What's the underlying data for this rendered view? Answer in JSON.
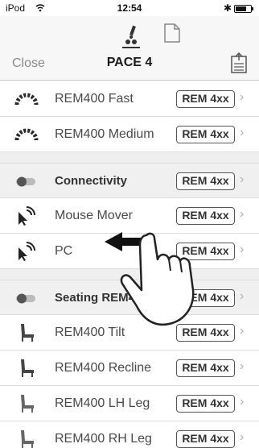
{
  "status_bar": {
    "carrier": "iPod",
    "time": "12:54"
  },
  "nav": {
    "close_label": "Close",
    "title": "PACE 4"
  },
  "sections": [
    {
      "type": "row",
      "icon": "speed-gauge-icon",
      "label": "REM400 Fast",
      "badge": "REM 4xx"
    },
    {
      "type": "row",
      "icon": "speed-gauge-icon",
      "label": "REM400 Medium",
      "badge": "REM 4xx"
    },
    {
      "type": "header",
      "icon": "toggle-icon",
      "label": "Connectivity",
      "badge": "REM 4xx"
    },
    {
      "type": "row",
      "icon": "mouse-wireless-icon",
      "label": "Mouse Mover",
      "badge": "REM 4xx"
    },
    {
      "type": "row",
      "icon": "mouse-wireless-icon",
      "label": "PC",
      "badge": "REM 4xx"
    },
    {
      "type": "header",
      "icon": "toggle-icon",
      "label": "Seating REM400",
      "badge": "REM 4xx"
    },
    {
      "type": "row",
      "icon": "seat-icon",
      "label": "REM400 Tilt",
      "badge": "REM 4xx"
    },
    {
      "type": "row",
      "icon": "seat-icon",
      "label": "REM400 Recline",
      "badge": "REM 4xx"
    },
    {
      "type": "row",
      "icon": "seat-icon",
      "label": "REM400 LH Leg",
      "badge": "REM 4xx"
    },
    {
      "type": "row",
      "icon": "seat-icon",
      "label": "REM400 RH Leg",
      "badge": "REM 4xx"
    }
  ],
  "colors": {
    "nav_bg": "#f7f7f7",
    "header_bg": "#f0f0f0",
    "text": "#4a4a4a"
  }
}
